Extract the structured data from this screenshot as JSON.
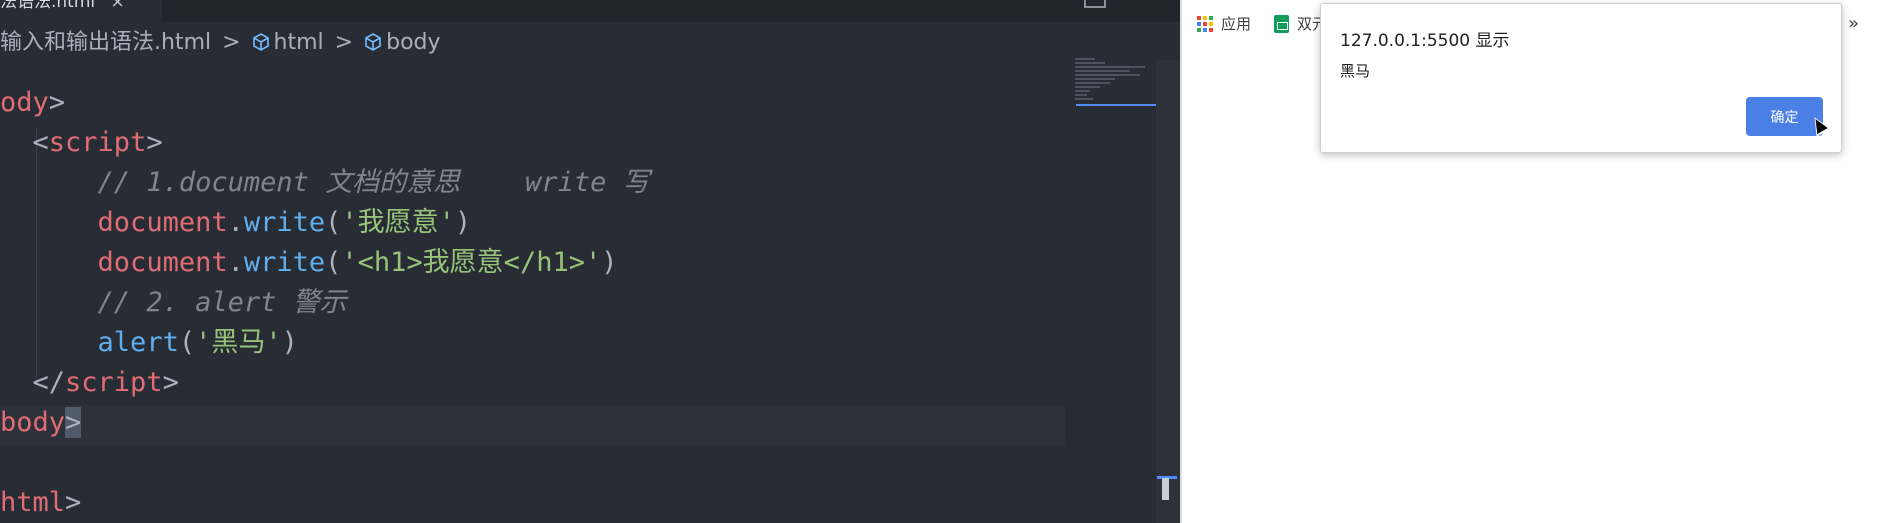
{
  "editor": {
    "tab": {
      "title": "法语法.html",
      "close": "×"
    },
    "breadcrumb": {
      "file": "输入和输出语法.html",
      "sep": ">",
      "item1": "html",
      "item2": "body"
    },
    "code": {
      "l1_tag": "ody",
      "l2_tag": "script",
      "l3_comment": "// 1.document 文档的意思    write 写",
      "l4_obj": "document",
      "l4_method": "write",
      "l4_arg": "'我愿意'",
      "l5_obj": "document",
      "l5_method": "write",
      "l5_arg": "'<h1>我愿意</h1>'",
      "l6_comment": "// 2. alert 警示",
      "l7_fn": "alert",
      "l7_arg": "'黑马'",
      "l8_tag": "script",
      "l9_tag": "body",
      "l10_tag": "html"
    }
  },
  "browser": {
    "bookmarks": {
      "apps": "应用",
      "item2": "双元",
      "more": "»"
    },
    "alert": {
      "origin": "127.0.0.1:5500 显示",
      "message": "黑马",
      "ok": "确定"
    }
  }
}
